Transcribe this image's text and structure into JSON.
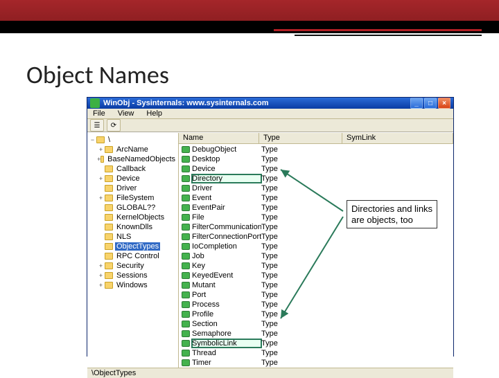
{
  "slide": {
    "title": "Object Names"
  },
  "window": {
    "title": "WinObj - Sysinternals: www.sysinternals.com",
    "buttons": {
      "min": "_",
      "max": "□",
      "close": "×"
    }
  },
  "menu": {
    "file": "File",
    "view": "View",
    "help": "Help"
  },
  "columns": {
    "name": "Name",
    "type": "Type",
    "symlink": "SymLink"
  },
  "tree": {
    "root": "\\",
    "items": [
      {
        "label": "ArcName",
        "expander": "+"
      },
      {
        "label": "BaseNamedObjects",
        "expander": "+"
      },
      {
        "label": "Callback",
        "expander": ""
      },
      {
        "label": "Device",
        "expander": "+"
      },
      {
        "label": "Driver",
        "expander": ""
      },
      {
        "label": "FileSystem",
        "expander": "+"
      },
      {
        "label": "GLOBAL??",
        "expander": ""
      },
      {
        "label": "KernelObjects",
        "expander": ""
      },
      {
        "label": "KnownDlls",
        "expander": ""
      },
      {
        "label": "NLS",
        "expander": ""
      },
      {
        "label": "ObjectTypes",
        "expander": "",
        "selected": true
      },
      {
        "label": "RPC Control",
        "expander": ""
      },
      {
        "label": "Security",
        "expander": "+"
      },
      {
        "label": "Sessions",
        "expander": "+"
      },
      {
        "label": "Windows",
        "expander": "+"
      }
    ]
  },
  "list": {
    "type_label": "Type",
    "items": [
      {
        "name": "DebugObject"
      },
      {
        "name": "Desktop"
      },
      {
        "name": "Device"
      },
      {
        "name": "Directory",
        "highlight": "dir"
      },
      {
        "name": "Driver"
      },
      {
        "name": "Event"
      },
      {
        "name": "EventPair"
      },
      {
        "name": "File"
      },
      {
        "name": "FilterCommunicationPort"
      },
      {
        "name": "FilterConnectionPort"
      },
      {
        "name": "IoCompletion"
      },
      {
        "name": "Job"
      },
      {
        "name": "Key"
      },
      {
        "name": "KeyedEvent"
      },
      {
        "name": "Mutant"
      },
      {
        "name": "Port"
      },
      {
        "name": "Process"
      },
      {
        "name": "Profile"
      },
      {
        "name": "Section"
      },
      {
        "name": "Semaphore"
      },
      {
        "name": "SymbolicLink",
        "highlight": "sym"
      },
      {
        "name": "Thread"
      },
      {
        "name": "Timer"
      }
    ]
  },
  "status": {
    "path": "\\ObjectTypes"
  },
  "callout": {
    "line1": "Directories and links",
    "line2": "are objects, too"
  }
}
